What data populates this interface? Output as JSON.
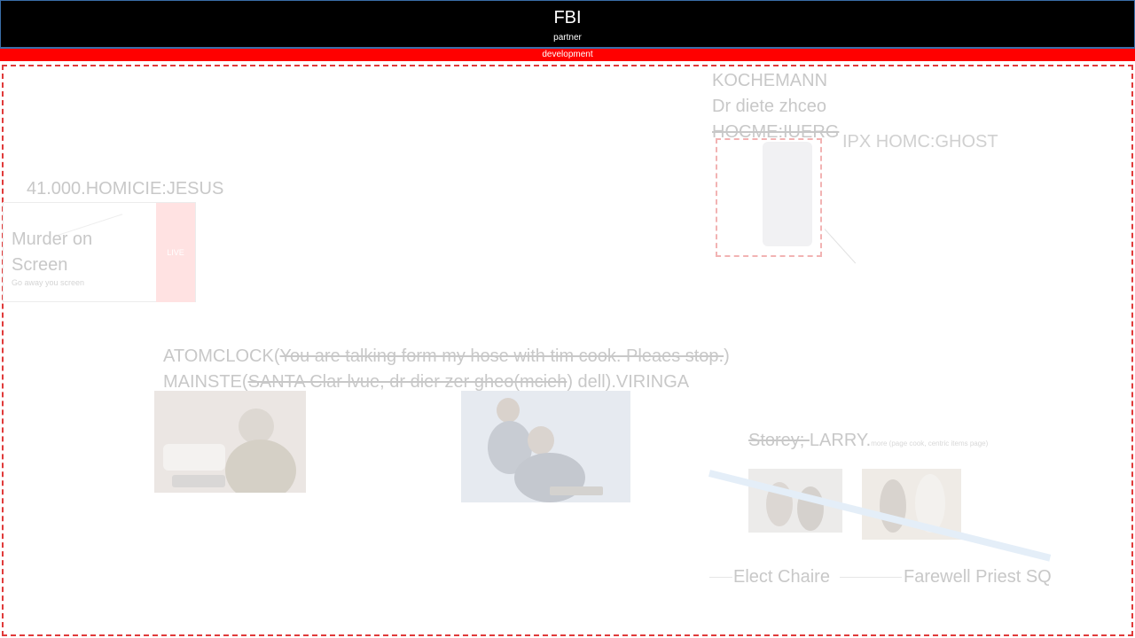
{
  "header": {
    "title": "FBI",
    "subtitle": "partner"
  },
  "dev_bar": {
    "label": "development"
  },
  "profile": {
    "lines": [
      "KOCHEMANN",
      "Dr diete zhceo",
      "HOCME:IUERG"
    ],
    "tag": "IPX HOMC:GHOST"
  },
  "homicide_label": "41.000.HOMICIE:JESUS",
  "news_card": {
    "headline": "Murder on Screen",
    "caption": "Go away you screen",
    "live_badge": "LIVE"
  },
  "atom_block": {
    "line1_prefix": "ATOMCLOCK(",
    "line1_struck": "You are talking form my hose with tim cook. Pleaes stop.",
    "line1_suffix": ")",
    "line2_prefix": "MAINSTE(",
    "line2_struck": "SANTA Clar lvue, dr dier zer gheo(mcieh",
    "line2_suffix": ") dell).VIRINGA"
  },
  "storey": {
    "struck": "Storey; ",
    "name": "LARRY.",
    "small_note": "more (page cook, centric items page)"
  },
  "captions": {
    "left": "Elect Chaire",
    "right": "Farewell Priest SQ"
  },
  "colors": {
    "header_bg": "#000000",
    "dev_bar_bg": "#ff0000",
    "frame_border": "#e03a3a"
  }
}
